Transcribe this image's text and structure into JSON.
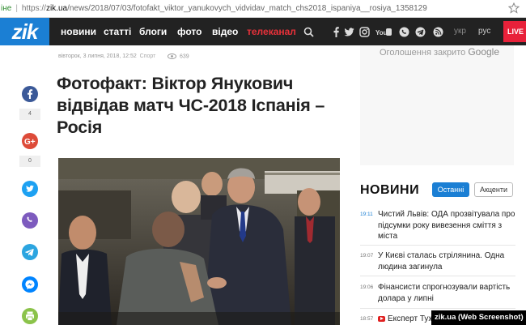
{
  "browser": {
    "security_label": "іне",
    "url_protocol": "https://",
    "url_domain": "zik.ua",
    "url_path": "/news/2018/07/03/fotofakt_viktor_yanukovych_vidvidav_match_chs2018_ispaniya__rosiya_1358129"
  },
  "nav": {
    "logo": "zik",
    "items": [
      "новини",
      "статті",
      "блоги",
      "фото",
      "відео",
      "телеканал"
    ],
    "lang_ukr": "укр",
    "lang_rus": "рус",
    "live": "LIVE"
  },
  "article": {
    "date": "вівторок, 3 липня, 2018, 12:52",
    "category": "Спорт",
    "views": "639",
    "title": "Фотофакт: Віктор Янукович відвідав матч ЧС-2018 Іспанія – Росія"
  },
  "share": {
    "facebook_count": "4",
    "google_count": "0"
  },
  "ad": {
    "closed_text": "Оголошення закрито",
    "brand": "Google"
  },
  "news": {
    "heading": "НОВИНИ",
    "tab_latest": "Останні",
    "tab_accents": "Акценти",
    "items": [
      {
        "time": "19:11",
        "text": "Чистий Львів: ОДА прозвітувала про підсумки року вивезення сміття з міста"
      },
      {
        "time": "19:07",
        "text": "У Києві сталась стрілянина. Одна людина загинула"
      },
      {
        "time": "19:06",
        "text": "Фінансисти спрогнозували вартість долара у липні"
      },
      {
        "time": "18:57",
        "text": "Експерт Туж"
      }
    ]
  },
  "watermark": "zik.ua (Web Screenshot)",
  "colors": {
    "brand_blue": "#1b7fd4",
    "nav_bg": "#222222",
    "tv_red": "#e8313a",
    "live_red": "#e8213a"
  },
  "icons": {
    "nav": [
      "search-icon",
      "facebook-icon",
      "twitter-icon",
      "instagram-icon",
      "youtube-icon",
      "viber-icon",
      "telegram-icon",
      "rss-icon"
    ],
    "share": [
      "facebook-icon",
      "google-plus-icon",
      "twitter-icon",
      "viber-icon",
      "telegram-icon",
      "messenger-icon",
      "print-icon"
    ]
  }
}
